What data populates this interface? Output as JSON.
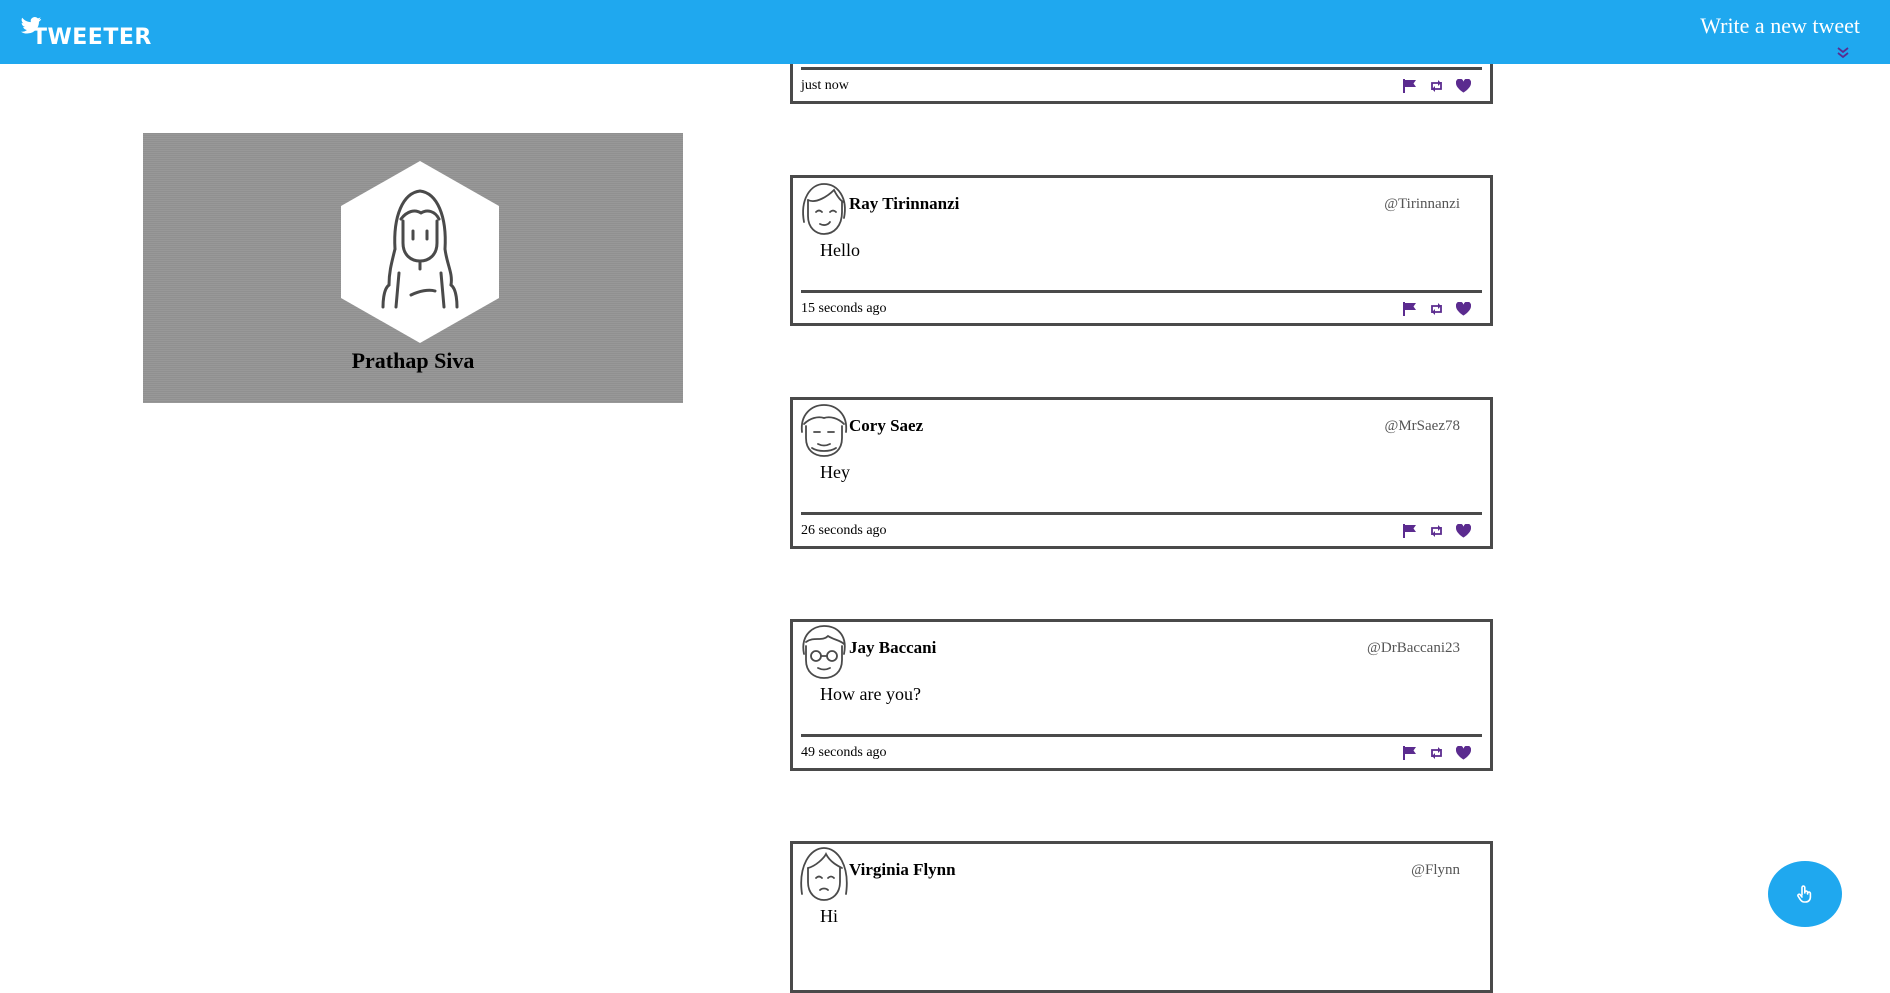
{
  "header": {
    "brand": "TWEETER",
    "write_link": "Write a new tweet"
  },
  "profile": {
    "name": "Prathap Siva"
  },
  "tweets": [
    {
      "name": "",
      "handle": "",
      "text": "",
      "time": "just now"
    },
    {
      "name": "Ray Tirinnanzi",
      "handle": "@Tirinnanzi",
      "text": "Hello",
      "time": "15 seconds ago"
    },
    {
      "name": "Cory Saez",
      "handle": "@MrSaez78",
      "text": "Hey",
      "time": "26 seconds ago"
    },
    {
      "name": "Jay Baccani",
      "handle": "@DrBaccani23",
      "text": "How are you?",
      "time": "49 seconds ago"
    },
    {
      "name": "Virginia Flynn",
      "handle": "@Flynn",
      "text": "Hi",
      "time": ""
    }
  ],
  "icons": {
    "action_color": "#5b2b8f",
    "brand_color": "#1fa8ef",
    "flag": "flag-icon",
    "retweet": "retweet-icon",
    "like": "heart-icon",
    "chevron": "chevron-double-down-icon",
    "fab": "hand-pointer-icon"
  }
}
